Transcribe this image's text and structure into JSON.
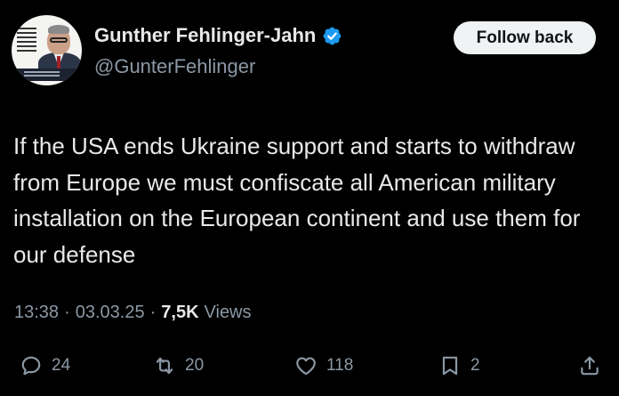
{
  "author": {
    "name": "Gunther Fehlinger-Jahn",
    "handle": "@GunterFehlinger",
    "verified": true,
    "verified_color": "#1d9bf0"
  },
  "follow_button": {
    "label": "Follow back"
  },
  "tweet": {
    "text": "If the USA ends Ukraine support and starts to withdraw from Europe we must confiscate all American military installation on the European continent and use them for our defense",
    "time": "13:38",
    "date": "03.03.25",
    "separator": "·",
    "views_count": "7,5K",
    "views_label": "Views"
  },
  "actions": {
    "reply": {
      "icon": "reply-icon",
      "count": "24"
    },
    "repost": {
      "icon": "repost-icon",
      "count": "20"
    },
    "like": {
      "icon": "heart-icon",
      "count": "118"
    },
    "bookmark": {
      "icon": "bookmark-icon",
      "count": "2"
    },
    "share": {
      "icon": "share-icon"
    }
  },
  "colors": {
    "background": "#000000",
    "text": "#e7e9ea",
    "secondary_text": "#8b98a5",
    "button_bg": "#eff3f4"
  }
}
